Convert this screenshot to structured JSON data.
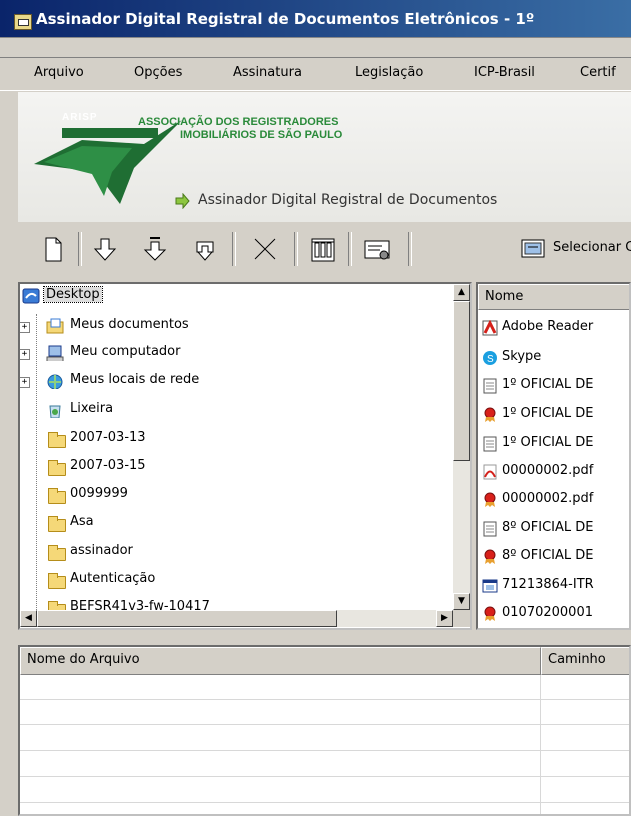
{
  "window": {
    "title": "Assinador Digital Registral de Documentos Eletrônicos - 1º"
  },
  "menu": [
    "Arquivo",
    "Opções",
    "Assinatura",
    "Legislação",
    "ICP-Brasil",
    "Certif"
  ],
  "banner": {
    "logo_text": "ARISP",
    "org_line1": "ASSOCIAÇÃO DOS REGISTRADORES",
    "org_line2": "IMOBILIÁRIOS DE SÃO PAULO",
    "subtitle": "Assinador Digital Registral de Documentos"
  },
  "toolbar": {
    "buttons": [
      "new-icon",
      "down-arrow-icon",
      "down-arrow-bar-icon",
      "download-icon",
      "cut-icon",
      "properties-icon",
      "certificate-icon"
    ],
    "select_label": "Selecionar C"
  },
  "tree": {
    "items": [
      {
        "label": "Desktop",
        "icon": "desktop-icon",
        "selected": true
      },
      {
        "label": "Meus documentos",
        "icon": "documents-icon"
      },
      {
        "label": "Meu computador",
        "icon": "computer-icon"
      },
      {
        "label": "Meus locais de rede",
        "icon": "network-icon"
      },
      {
        "label": "Lixeira",
        "icon": "recycle-bin-icon"
      },
      {
        "label": "2007-03-13",
        "icon": "folder-icon"
      },
      {
        "label": "2007-03-15",
        "icon": "folder-icon"
      },
      {
        "label": "0099999",
        "icon": "folder-icon"
      },
      {
        "label": "Asa",
        "icon": "folder-icon"
      },
      {
        "label": "assinador",
        "icon": "folder-icon"
      },
      {
        "label": "Autenticação",
        "icon": "folder-icon"
      },
      {
        "label": "BEFSR41v3-fw-10417",
        "icon": "folder-icon"
      }
    ]
  },
  "filelist": {
    "header": "Nome",
    "items": [
      {
        "label": "Adobe Reader",
        "icon": "adobe-reader-icon"
      },
      {
        "label": "Skype",
        "icon": "skype-icon"
      },
      {
        "label": "1º OFICIAL DE",
        "icon": "text-file-icon"
      },
      {
        "label": "1º OFICIAL DE",
        "icon": "certificate-file-icon"
      },
      {
        "label": "1º OFICIAL DE",
        "icon": "text-file-icon"
      },
      {
        "label": "00000002.pdf",
        "icon": "pdf-icon"
      },
      {
        "label": "00000002.pdf",
        "icon": "certificate-file-icon"
      },
      {
        "label": "8º OFICIAL DE",
        "icon": "text-file-icon"
      },
      {
        "label": "8º OFICIAL DE",
        "icon": "certificate-file-icon"
      },
      {
        "label": "71213864-ITR",
        "icon": "app-file-icon"
      },
      {
        "label": "01070200001",
        "icon": "certificate-file-icon"
      }
    ]
  },
  "bottom_table": {
    "columns": [
      "Nome do Arquivo",
      "Caminho"
    ]
  },
  "colors": {
    "title_bar": "#0a246a",
    "brand_green": "#2a8a3a",
    "selection": "#316ac5"
  }
}
